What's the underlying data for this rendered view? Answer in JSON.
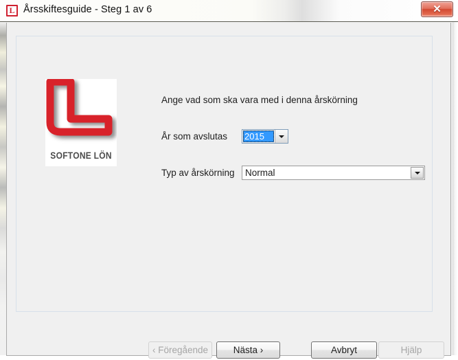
{
  "window": {
    "title": "Årsskiftesguide - Steg 1 av 6",
    "app_icon_letter": "L",
    "close_glyph": "✕",
    "close_icon_name": "close-icon"
  },
  "logo": {
    "caption": "SOFTONE LÖN",
    "mark_color": "#d8232a",
    "mark_name": "softone-lon-logo"
  },
  "content": {
    "intro_text": "Ange vad som ska vara med i denna årskörning",
    "fields": [
      {
        "label": "År som avslutas",
        "value": "2015",
        "control": "combobox",
        "state": "focused-selected"
      },
      {
        "label": "Typ av årskörning",
        "value": "Normal",
        "control": "combobox",
        "state": "normal"
      }
    ]
  },
  "buttons": {
    "previous": {
      "label": "‹ Föregående",
      "enabled": false
    },
    "next": {
      "label": "Nästa ›",
      "enabled": true,
      "default": true
    },
    "cancel": {
      "label": "Avbryt",
      "enabled": true
    },
    "help": {
      "label": "Hjälp",
      "enabled": false
    }
  },
  "colors": {
    "accent_red": "#cf202e",
    "selection_blue": "#3399ff",
    "dialog_face": "#f0f0f0",
    "panel_border": "#d7e0ea"
  }
}
